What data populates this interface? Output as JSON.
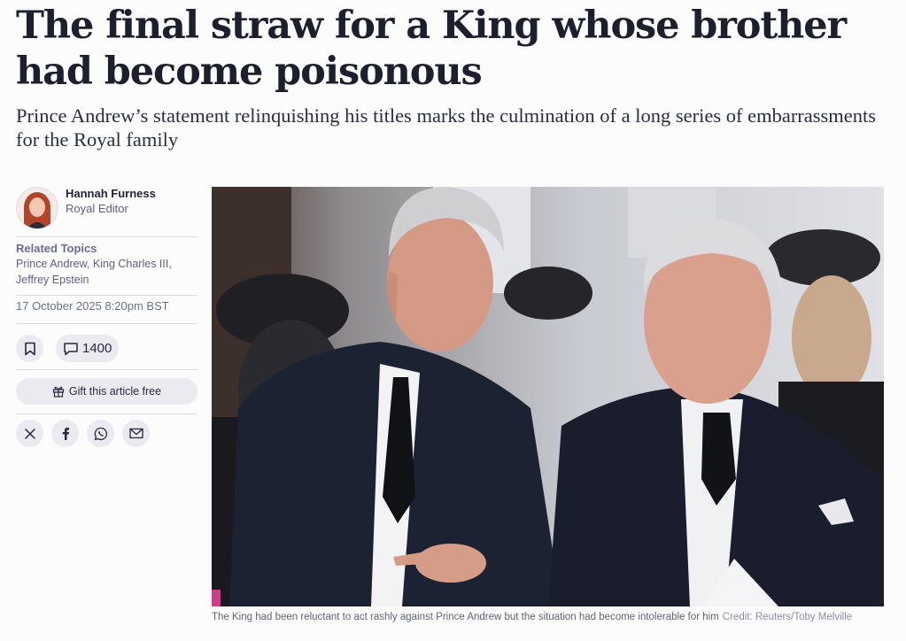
{
  "article": {
    "headline": "The final straw for a King whose brother had become poisonous",
    "standfirst": "Prince Andrew’s statement relinquishing his titles marks the culmination of a long series of embarrassments for the Royal family"
  },
  "author": {
    "name": "Hannah Furness",
    "role": "Royal Editor"
  },
  "related": {
    "title": "Related Topics",
    "topics": [
      "Prince Andrew",
      "King Charles III",
      "Jeffrey Epstein"
    ]
  },
  "meta": {
    "date": "17 October 2025 8:20pm BST",
    "comment_count": "1400",
    "gift_label": "Gift this article free"
  },
  "share": {
    "icons": [
      "x-icon",
      "facebook-icon",
      "whatsapp-icon",
      "email-icon"
    ]
  },
  "image": {
    "caption": "The King had been reluctant to act rashly against Prince Andrew but the situation had become intolerable for him",
    "credit": "Credit: Reuters/Toby Melville"
  },
  "colors": {
    "text": "#1c1f2e",
    "muted": "#5a5d8a",
    "button_bg": "#eceaf1",
    "background": "#fdfcfd"
  }
}
